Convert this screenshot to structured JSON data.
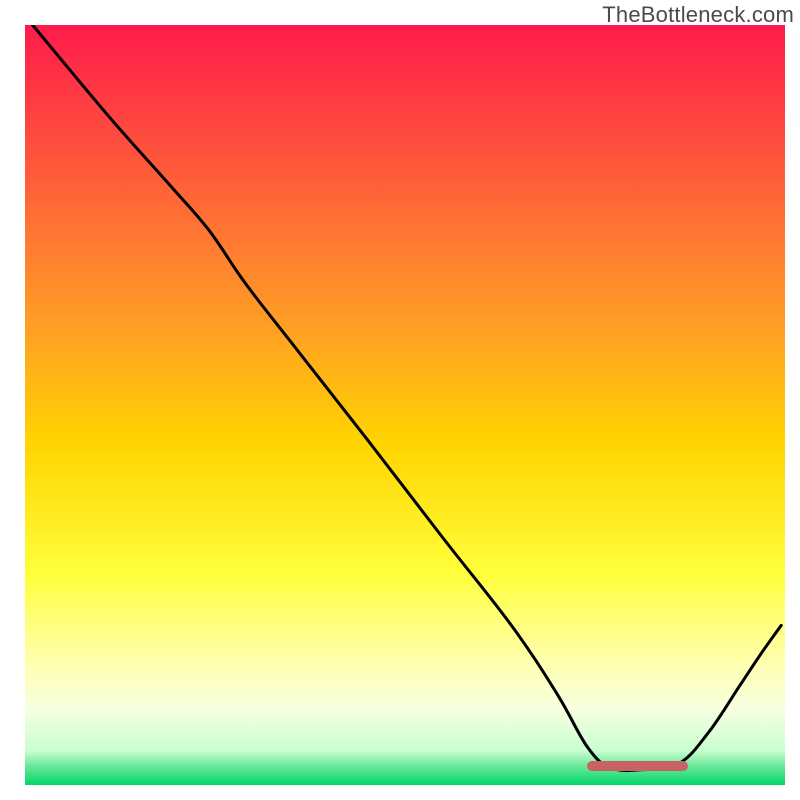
{
  "watermark": "TheBottleneck.com",
  "marker": {
    "left_frac": 0.74,
    "right_frac": 0.873,
    "y_frac": 0.975,
    "color": "#c86265"
  },
  "chart_data": {
    "type": "line",
    "title": "",
    "xlabel": "",
    "ylabel": "",
    "xlim": [
      0,
      100
    ],
    "ylim": [
      0,
      100
    ],
    "grid": false,
    "legend": false,
    "gradient_stops": [
      {
        "offset": 0.0,
        "color": "#ff1b4b"
      },
      {
        "offset": 0.2,
        "color": "#ff5d3a"
      },
      {
        "offset": 0.4,
        "color": "#ffa024"
      },
      {
        "offset": 0.55,
        "color": "#ffd400"
      },
      {
        "offset": 0.72,
        "color": "#ffff3a"
      },
      {
        "offset": 0.84,
        "color": "#ffffb0"
      },
      {
        "offset": 0.9,
        "color": "#f7ffe0"
      },
      {
        "offset": 0.955,
        "color": "#c8ffd0"
      },
      {
        "offset": 0.975,
        "color": "#6be89a"
      },
      {
        "offset": 1.0,
        "color": "#00d66a"
      },
      {
        "offset_axis_note": "top-to-bottom"
      }
    ],
    "series": [
      {
        "name": "curve",
        "stroke": "#000000",
        "stroke_width": 3,
        "points_frac": [
          [
            0.01,
            0.0
          ],
          [
            0.11,
            0.12
          ],
          [
            0.19,
            0.21
          ],
          [
            0.242,
            0.27
          ],
          [
            0.29,
            0.34
          ],
          [
            0.36,
            0.43
          ],
          [
            0.45,
            0.545
          ],
          [
            0.55,
            0.675
          ],
          [
            0.64,
            0.79
          ],
          [
            0.7,
            0.88
          ],
          [
            0.74,
            0.95
          ],
          [
            0.77,
            0.977
          ],
          [
            0.81,
            0.98
          ],
          [
            0.86,
            0.972
          ],
          [
            0.9,
            0.93
          ],
          [
            0.94,
            0.87
          ],
          [
            0.97,
            0.825
          ],
          [
            0.995,
            0.79
          ]
        ]
      }
    ]
  }
}
